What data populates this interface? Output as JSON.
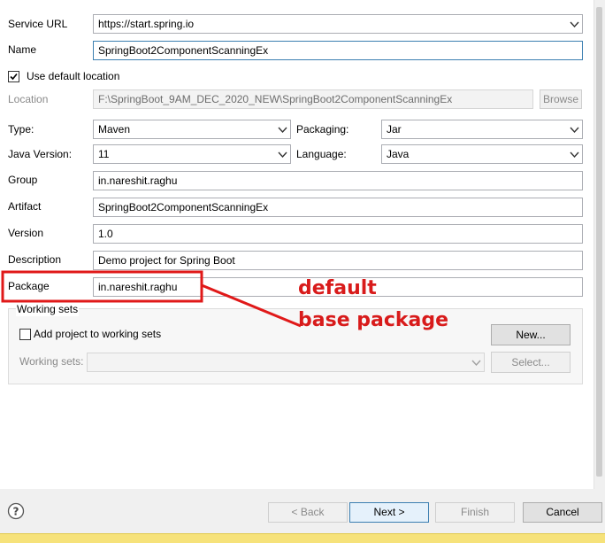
{
  "form": {
    "service_url_label": "Service URL",
    "service_url_value": "https://start.spring.io",
    "name_label": "Name",
    "name_value": "SpringBoot2ComponentScanningEx",
    "use_default_location_label": "Use default location",
    "use_default_location_checked": true,
    "location_label": "Location",
    "location_value": "F:\\SpringBoot_9AM_DEC_2020_NEW\\SpringBoot2ComponentScanningEx",
    "browse_label": "Browse",
    "type_label": "Type:",
    "type_value": "Maven",
    "packaging_label": "Packaging:",
    "packaging_value": "Jar",
    "java_version_label": "Java Version:",
    "java_version_value": "11",
    "language_label": "Language:",
    "language_value": "Java",
    "group_label": "Group",
    "group_value": "in.nareshit.raghu",
    "artifact_label": "Artifact",
    "artifact_value": "SpringBoot2ComponentScanningEx",
    "version_label": "Version",
    "version_value": "1.0",
    "description_label": "Description",
    "description_value": "Demo project for Spring Boot",
    "package_label": "Package",
    "package_value": "in.nareshit.raghu"
  },
  "working_sets": {
    "title": "Working sets",
    "add_label": "Add project to working sets",
    "add_checked": false,
    "new_button": "New...",
    "sets_label": "Working sets:",
    "sets_value": "",
    "select_button": "Select..."
  },
  "annotation": {
    "line1": "default",
    "line2": "base package",
    "color": "#d81b1b"
  },
  "footer": {
    "help_icon": "question-mark-icon",
    "back_button": "< Back",
    "next_button": "Next >",
    "finish_button": "Finish",
    "cancel_button": "Cancel"
  }
}
